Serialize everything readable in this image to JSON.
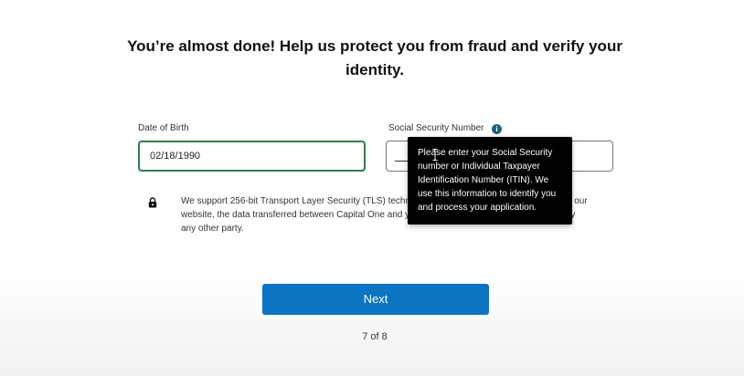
{
  "heading": "You’re almost done! Help us protect you from fraud and verify your identity.",
  "dob": {
    "label": "Date of Birth",
    "value": "02/18/1990"
  },
  "ssn": {
    "label": "Social Security Number",
    "info_icon": "info-icon",
    "tooltip_visible_text": "Please enter your Social Security number or Individual Taxpayer Identification Number (ITIN). We use this information to identify you and process your application."
  },
  "security_notice": {
    "icon": "lock-icon",
    "text": "We support 256-bit Transport Layer Security (TLS) technology. This means that when you are on our website, the data transferred between Capital One and you is encrypted and cannot be viewed by any other party."
  },
  "next_button": {
    "label": "Next"
  },
  "progress": {
    "text": "7 of 8",
    "current": 7,
    "total": 8
  },
  "colors": {
    "primary_button": "#0d74c4",
    "focus_border": "#2d7d4e",
    "info_icon": "#255f82",
    "tooltip_bg": "#000000"
  }
}
